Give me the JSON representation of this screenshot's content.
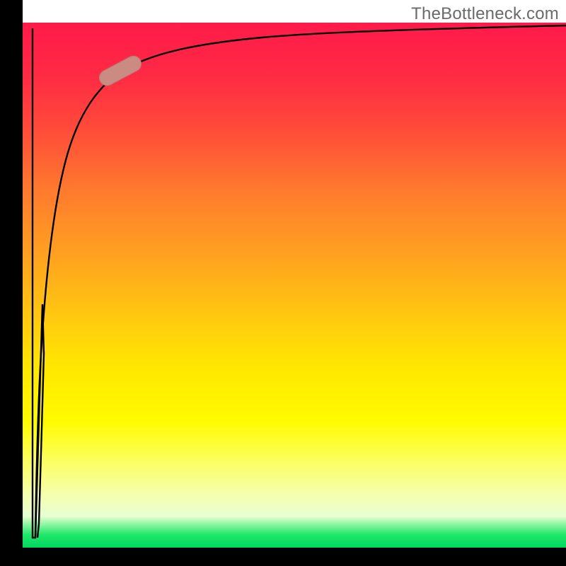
{
  "attribution": "TheBottleneck.com",
  "colors": {
    "axis": "#000000",
    "curve": "#000000",
    "marker_fill": "#c98b82",
    "marker_stroke": "#a86a62",
    "gradient_top": "#ff1a4a",
    "gradient_bottom": "#00d860"
  },
  "chart_data": {
    "type": "line",
    "title": "",
    "xlabel": "",
    "ylabel": "",
    "xlim": [
      0,
      100
    ],
    "ylim": [
      0,
      100
    ],
    "grid": false,
    "series": [
      {
        "name": "curve",
        "x": [
          0,
          0.5,
          1,
          1.5,
          2,
          3,
          4,
          5,
          7,
          10,
          14,
          20,
          30,
          45,
          65,
          85,
          100
        ],
        "y": [
          100,
          30,
          5,
          35,
          58,
          72,
          79,
          83,
          87,
          89.5,
          91,
          92.3,
          93.5,
          94.5,
          95.3,
          95.8,
          96.2
        ]
      }
    ],
    "marker": {
      "on_series": "curve",
      "x_range": [
        14,
        20
      ],
      "center": {
        "x": 17,
        "y": 91.6
      }
    },
    "legend": null
  }
}
